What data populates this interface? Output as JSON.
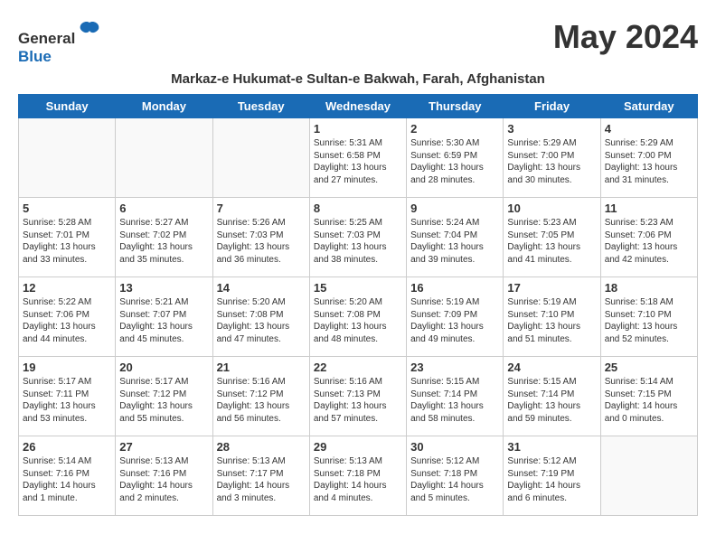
{
  "header": {
    "logo_general": "General",
    "logo_blue": "Blue",
    "month_year": "May 2024"
  },
  "subtitle": "Markaz-e Hukumat-e Sultan-e Bakwah, Farah, Afghanistan",
  "days_of_week": [
    "Sunday",
    "Monday",
    "Tuesday",
    "Wednesday",
    "Thursday",
    "Friday",
    "Saturday"
  ],
  "weeks": [
    [
      {
        "day": "",
        "info": ""
      },
      {
        "day": "",
        "info": ""
      },
      {
        "day": "",
        "info": ""
      },
      {
        "day": "1",
        "info": "Sunrise: 5:31 AM\nSunset: 6:58 PM\nDaylight: 13 hours\nand 27 minutes."
      },
      {
        "day": "2",
        "info": "Sunrise: 5:30 AM\nSunset: 6:59 PM\nDaylight: 13 hours\nand 28 minutes."
      },
      {
        "day": "3",
        "info": "Sunrise: 5:29 AM\nSunset: 7:00 PM\nDaylight: 13 hours\nand 30 minutes."
      },
      {
        "day": "4",
        "info": "Sunrise: 5:29 AM\nSunset: 7:00 PM\nDaylight: 13 hours\nand 31 minutes."
      }
    ],
    [
      {
        "day": "5",
        "info": "Sunrise: 5:28 AM\nSunset: 7:01 PM\nDaylight: 13 hours\nand 33 minutes."
      },
      {
        "day": "6",
        "info": "Sunrise: 5:27 AM\nSunset: 7:02 PM\nDaylight: 13 hours\nand 35 minutes."
      },
      {
        "day": "7",
        "info": "Sunrise: 5:26 AM\nSunset: 7:03 PM\nDaylight: 13 hours\nand 36 minutes."
      },
      {
        "day": "8",
        "info": "Sunrise: 5:25 AM\nSunset: 7:03 PM\nDaylight: 13 hours\nand 38 minutes."
      },
      {
        "day": "9",
        "info": "Sunrise: 5:24 AM\nSunset: 7:04 PM\nDaylight: 13 hours\nand 39 minutes."
      },
      {
        "day": "10",
        "info": "Sunrise: 5:23 AM\nSunset: 7:05 PM\nDaylight: 13 hours\nand 41 minutes."
      },
      {
        "day": "11",
        "info": "Sunrise: 5:23 AM\nSunset: 7:06 PM\nDaylight: 13 hours\nand 42 minutes."
      }
    ],
    [
      {
        "day": "12",
        "info": "Sunrise: 5:22 AM\nSunset: 7:06 PM\nDaylight: 13 hours\nand 44 minutes."
      },
      {
        "day": "13",
        "info": "Sunrise: 5:21 AM\nSunset: 7:07 PM\nDaylight: 13 hours\nand 45 minutes."
      },
      {
        "day": "14",
        "info": "Sunrise: 5:20 AM\nSunset: 7:08 PM\nDaylight: 13 hours\nand 47 minutes."
      },
      {
        "day": "15",
        "info": "Sunrise: 5:20 AM\nSunset: 7:08 PM\nDaylight: 13 hours\nand 48 minutes."
      },
      {
        "day": "16",
        "info": "Sunrise: 5:19 AM\nSunset: 7:09 PM\nDaylight: 13 hours\nand 49 minutes."
      },
      {
        "day": "17",
        "info": "Sunrise: 5:19 AM\nSunset: 7:10 PM\nDaylight: 13 hours\nand 51 minutes."
      },
      {
        "day": "18",
        "info": "Sunrise: 5:18 AM\nSunset: 7:10 PM\nDaylight: 13 hours\nand 52 minutes."
      }
    ],
    [
      {
        "day": "19",
        "info": "Sunrise: 5:17 AM\nSunset: 7:11 PM\nDaylight: 13 hours\nand 53 minutes."
      },
      {
        "day": "20",
        "info": "Sunrise: 5:17 AM\nSunset: 7:12 PM\nDaylight: 13 hours\nand 55 minutes."
      },
      {
        "day": "21",
        "info": "Sunrise: 5:16 AM\nSunset: 7:12 PM\nDaylight: 13 hours\nand 56 minutes."
      },
      {
        "day": "22",
        "info": "Sunrise: 5:16 AM\nSunset: 7:13 PM\nDaylight: 13 hours\nand 57 minutes."
      },
      {
        "day": "23",
        "info": "Sunrise: 5:15 AM\nSunset: 7:14 PM\nDaylight: 13 hours\nand 58 minutes."
      },
      {
        "day": "24",
        "info": "Sunrise: 5:15 AM\nSunset: 7:14 PM\nDaylight: 13 hours\nand 59 minutes."
      },
      {
        "day": "25",
        "info": "Sunrise: 5:14 AM\nSunset: 7:15 PM\nDaylight: 14 hours\nand 0 minutes."
      }
    ],
    [
      {
        "day": "26",
        "info": "Sunrise: 5:14 AM\nSunset: 7:16 PM\nDaylight: 14 hours\nand 1 minute."
      },
      {
        "day": "27",
        "info": "Sunrise: 5:13 AM\nSunset: 7:16 PM\nDaylight: 14 hours\nand 2 minutes."
      },
      {
        "day": "28",
        "info": "Sunrise: 5:13 AM\nSunset: 7:17 PM\nDaylight: 14 hours\nand 3 minutes."
      },
      {
        "day": "29",
        "info": "Sunrise: 5:13 AM\nSunset: 7:18 PM\nDaylight: 14 hours\nand 4 minutes."
      },
      {
        "day": "30",
        "info": "Sunrise: 5:12 AM\nSunset: 7:18 PM\nDaylight: 14 hours\nand 5 minutes."
      },
      {
        "day": "31",
        "info": "Sunrise: 5:12 AM\nSunset: 7:19 PM\nDaylight: 14 hours\nand 6 minutes."
      },
      {
        "day": "",
        "info": ""
      }
    ]
  ]
}
